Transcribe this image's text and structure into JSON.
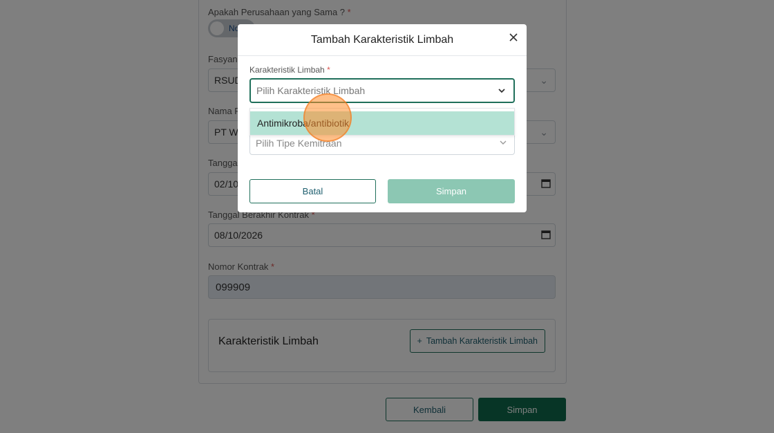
{
  "form": {
    "same_company_label": "Apakah Perusahaan yang Sama ?",
    "same_company_toggle_text": "No",
    "fasyankes_label": "Fasyank",
    "fasyankes_value": "RSUD",
    "company_name_label": "Nama Pe",
    "company_name_value": "PT W",
    "start_date_label": "Tanggal",
    "start_date_value": "02/10/",
    "end_date_label": "Tanggal Berakhir Kontrak",
    "end_date_value": "08/10/2026",
    "contract_number_label": "Nomor Kontrak",
    "contract_number_value": "099909",
    "required_mark": "*",
    "section_title": "Karakteristik Limbah",
    "add_button_label": "Tambah Karakteristik Limbah",
    "add_button_icon": "+",
    "back_button": "Kembali",
    "save_button": "Simpan"
  },
  "modal": {
    "title": "Tambah Karakteristik Limbah",
    "field_label": "Karakteristik Limbah",
    "required_mark": "*",
    "select_placeholder": "Pilih Karakteristik Limbah",
    "partnership_placeholder": "Pilih Tipe Kemitraan",
    "dropdown_options": [
      "Antimikroba/antibiotik"
    ],
    "cancel_button": "Batal",
    "save_button": "Simpan"
  },
  "colors": {
    "accent": "#0f6b4c",
    "accent_light": "#8cc7b3",
    "option_highlight": "#b4e2d4",
    "cursor_highlight": "#ff8c28"
  }
}
